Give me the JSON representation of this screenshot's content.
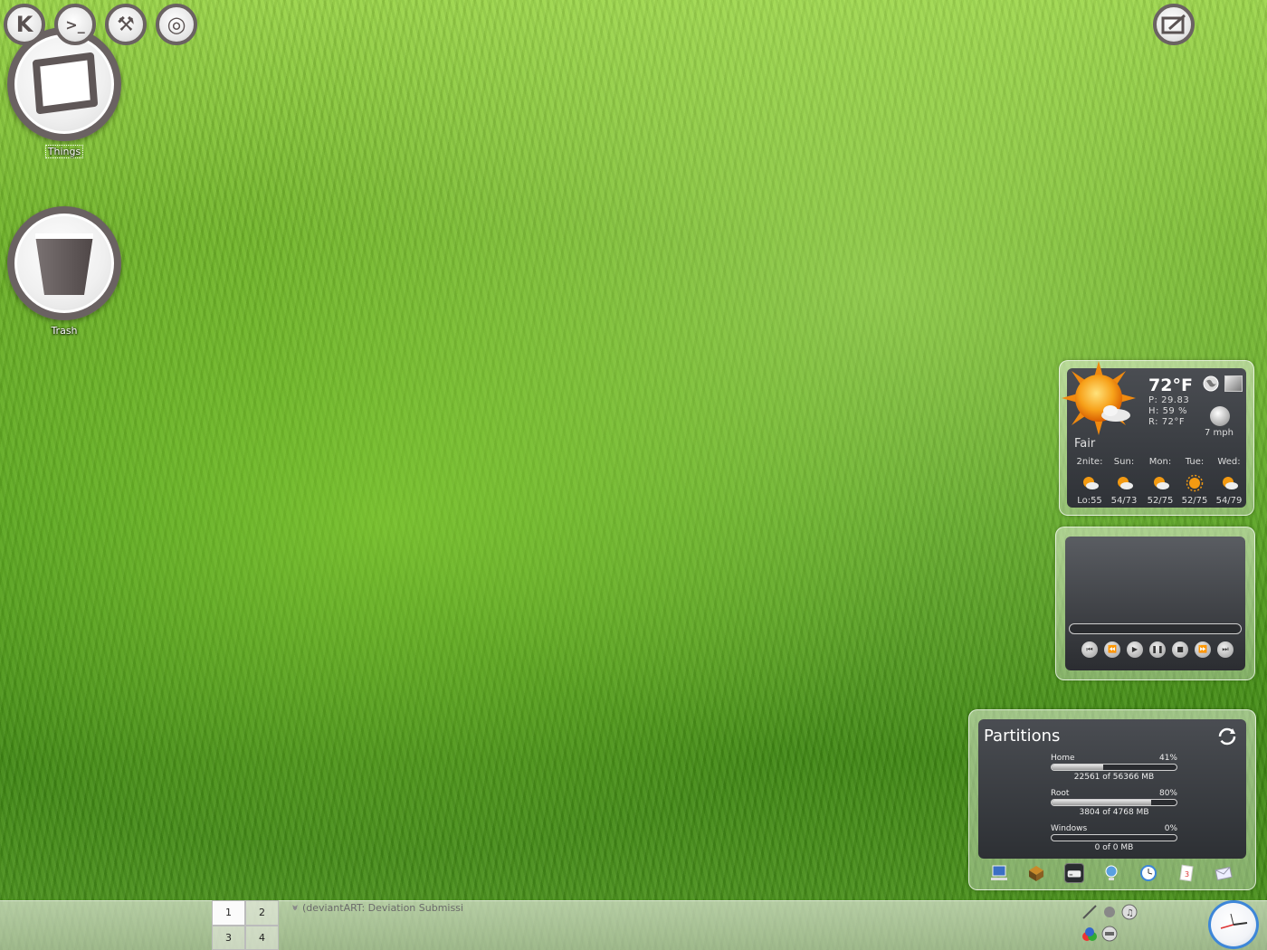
{
  "desktop": {
    "icons": [
      {
        "label": "Things",
        "icon": "folder-frame-icon"
      },
      {
        "label": "Trash",
        "icon": "trash-bin-icon"
      }
    ]
  },
  "weather": {
    "temp": "72°F",
    "pressure": "P: 29.83",
    "humidity": "H: 59 %",
    "real_feel": "R: 72°F",
    "condition": "Fair",
    "wind": "7 mph",
    "forecast": [
      {
        "day": "2nite:",
        "temps": "Lo:55"
      },
      {
        "day": "Sun:",
        "temps": "54/73"
      },
      {
        "day": "Mon:",
        "temps": "52/75"
      },
      {
        "day": "Tue:",
        "temps": "52/75"
      },
      {
        "day": "Wed:",
        "temps": "54/79"
      }
    ]
  },
  "player": {
    "controls": [
      "skip-back-icon",
      "rewind-icon",
      "play-icon",
      "pause-icon",
      "stop-icon",
      "fast-forward-icon",
      "skip-forward-icon"
    ]
  },
  "partitions": {
    "title": "Partitions",
    "items": [
      {
        "name": "Home",
        "percent": "41%",
        "fraction": 0.41,
        "size": "22561 of 56366 MB"
      },
      {
        "name": "Root",
        "percent": "80%",
        "fraction": 0.8,
        "size": "3804 of 4768 MB"
      },
      {
        "name": "Windows",
        "percent": "0%",
        "fraction": 0.0,
        "size": "0 of 0 MB"
      }
    ],
    "dock_icons": [
      "computer-icon",
      "package-icon",
      "drive-icon",
      "network-icon",
      "clock-icon",
      "document-icon",
      "mail-icon"
    ]
  },
  "taskbar": {
    "launchers": [
      {
        "name": "kmenu-button",
        "glyph": "K"
      },
      {
        "name": "terminal-button",
        "glyph": ">_"
      },
      {
        "name": "tools-button",
        "glyph": "⚒"
      },
      {
        "name": "search-button",
        "glyph": "◎"
      }
    ],
    "pager": [
      "1",
      "2",
      "3",
      "4"
    ],
    "active_desktop": "1",
    "task_title": "(deviantART: Deviation Submissi"
  },
  "colors": {
    "accent": "#3d86d8",
    "icon_ring": "#6a6262"
  }
}
